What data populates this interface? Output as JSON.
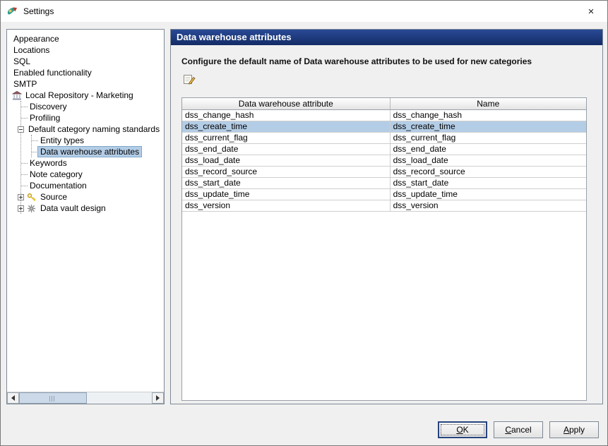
{
  "window": {
    "title": "Settings",
    "close_glyph": "×"
  },
  "tree": {
    "items": [
      {
        "label": "Appearance"
      },
      {
        "label": "Locations"
      },
      {
        "label": "SQL"
      },
      {
        "label": "Enabled functionality"
      },
      {
        "label": "SMTP"
      },
      {
        "label": "Local Repository - Marketing"
      },
      {
        "label": "Discovery"
      },
      {
        "label": "Profiling"
      },
      {
        "label": "Default category naming standards"
      },
      {
        "label": "Entity types"
      },
      {
        "label": "Data warehouse attributes",
        "selected": true
      },
      {
        "label": "Keywords"
      },
      {
        "label": "Note category"
      },
      {
        "label": "Documentation"
      },
      {
        "label": "Source"
      },
      {
        "label": "Data vault design"
      }
    ]
  },
  "content": {
    "header": "Data warehouse attributes",
    "instruction": "Configure the default name of Data warehouse attributes to be used for new categories",
    "table": {
      "columns": [
        "Data warehouse attribute",
        "Name"
      ],
      "selected_row": "dss_create_time",
      "rows": [
        {
          "attribute": "dss_change_hash",
          "name": "dss_change_hash"
        },
        {
          "attribute": "dss_create_time",
          "name": "dss_create_time"
        },
        {
          "attribute": "dss_current_flag",
          "name": "dss_current_flag"
        },
        {
          "attribute": "dss_end_date",
          "name": "dss_end_date"
        },
        {
          "attribute": "dss_load_date",
          "name": "dss_load_date"
        },
        {
          "attribute": "dss_record_source",
          "name": "dss_record_source"
        },
        {
          "attribute": "dss_start_date",
          "name": "dss_start_date"
        },
        {
          "attribute": "dss_update_time",
          "name": "dss_update_time"
        },
        {
          "attribute": "dss_version",
          "name": "dss_version"
        }
      ]
    }
  },
  "buttons": {
    "ok": {
      "mnemonic": "O",
      "rest": "K"
    },
    "cancel": {
      "mnemonic": "C",
      "rest": "ancel"
    },
    "apply": {
      "mnemonic": "A",
      "rest": "pply"
    }
  },
  "colors": {
    "section_header_bg": "#1b3575",
    "selection_bg": "#b4cde6",
    "panel_bg": "#f0f0f0"
  }
}
